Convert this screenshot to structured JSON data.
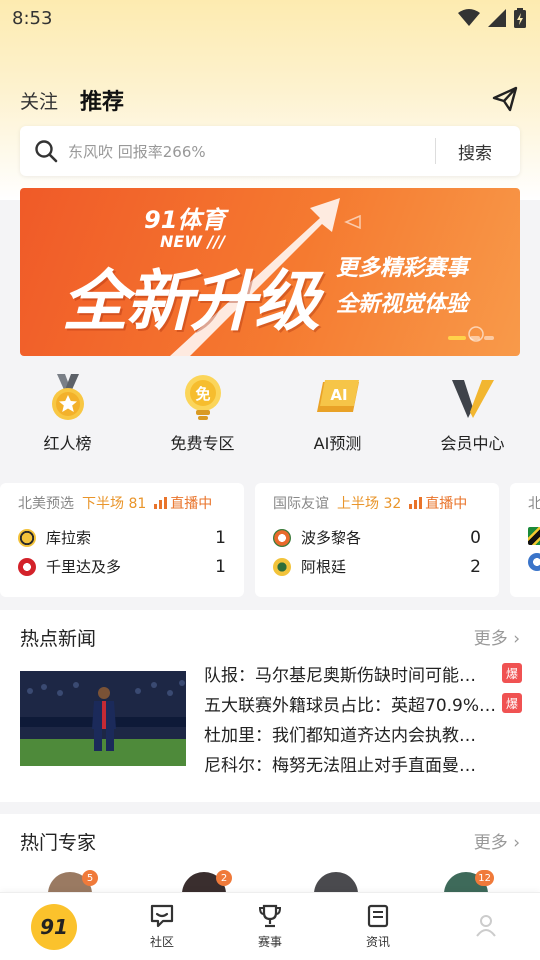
{
  "status_bar": {
    "time": "8:53"
  },
  "header": {
    "tabs": [
      {
        "label": "关注"
      },
      {
        "label": "推荐"
      }
    ]
  },
  "search": {
    "placeholder": "东风吹 回报率266%",
    "button_label": "搜索"
  },
  "banner": {
    "brand": "91体育",
    "tag": "NEW ///",
    "title": "全新升级",
    "subtitle_line1": "更多精彩赛事",
    "subtitle_line2": "全新视觉体验"
  },
  "quick_entries": [
    {
      "label": "红人榜",
      "icon": "medal-icon"
    },
    {
      "label": "免费专区",
      "icon": "free-bulb-icon"
    },
    {
      "label": "AI预测",
      "icon": "ai-icon"
    },
    {
      "label": "会员中心",
      "icon": "vip-icon"
    }
  ],
  "matches": [
    {
      "league": "北美预选",
      "period": "下半场 81",
      "live_label": "直播中",
      "home": {
        "name": "库拉索",
        "score": "1"
      },
      "away": {
        "name": "千里达及多",
        "score": "1"
      }
    },
    {
      "league": "国际友谊",
      "period": "上半场 32",
      "live_label": "直播中",
      "home": {
        "name": "波多黎各",
        "score": "0"
      },
      "away": {
        "name": "阿根廷",
        "score": "2"
      }
    },
    {
      "league": "北"
    }
  ],
  "news": {
    "title": "热点新闻",
    "more": "更多",
    "items": [
      {
        "text": "队报：马尔基尼奥斯伤缺时间可能…",
        "badge": "爆"
      },
      {
        "text": "五大联赛外籍球员占比：英超70.9%…",
        "badge": "爆"
      },
      {
        "text": "杜加里：我们都知道齐达内会执教…"
      },
      {
        "text": "尼科尔：梅努无法阻止对手直面曼…"
      }
    ]
  },
  "experts": {
    "title": "热门专家",
    "more": "更多",
    "badges": [
      "5",
      "2",
      "",
      "12"
    ]
  },
  "bottom_nav": {
    "items": [
      {
        "label": "91"
      },
      {
        "label": "社区"
      },
      {
        "label": "赛事"
      },
      {
        "label": "资讯"
      },
      {
        "label": ""
      }
    ]
  },
  "colors": {
    "accent_yellow": "#fbc22c",
    "live_orange": "#e9742b",
    "hot_red": "#f05252"
  }
}
